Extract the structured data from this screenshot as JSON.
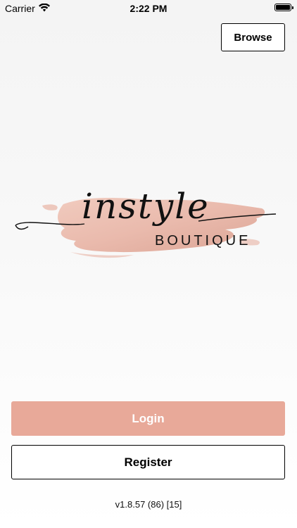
{
  "status_bar": {
    "carrier": "Carrier",
    "time": "2:22 PM",
    "icons": [
      "wifi-icon",
      "battery-icon"
    ]
  },
  "header": {
    "browse_label": "Browse"
  },
  "logo": {
    "script_text": "instyle",
    "wordmark": "BOUTIQUE",
    "brush_color": "#e8b3a4"
  },
  "actions": {
    "login_label": "Login",
    "register_label": "Register"
  },
  "footer": {
    "version": "v1.8.57 (86) [15]"
  },
  "colors": {
    "accent": "#e8a999",
    "text": "#000000",
    "button_text_light": "#ffffff"
  }
}
